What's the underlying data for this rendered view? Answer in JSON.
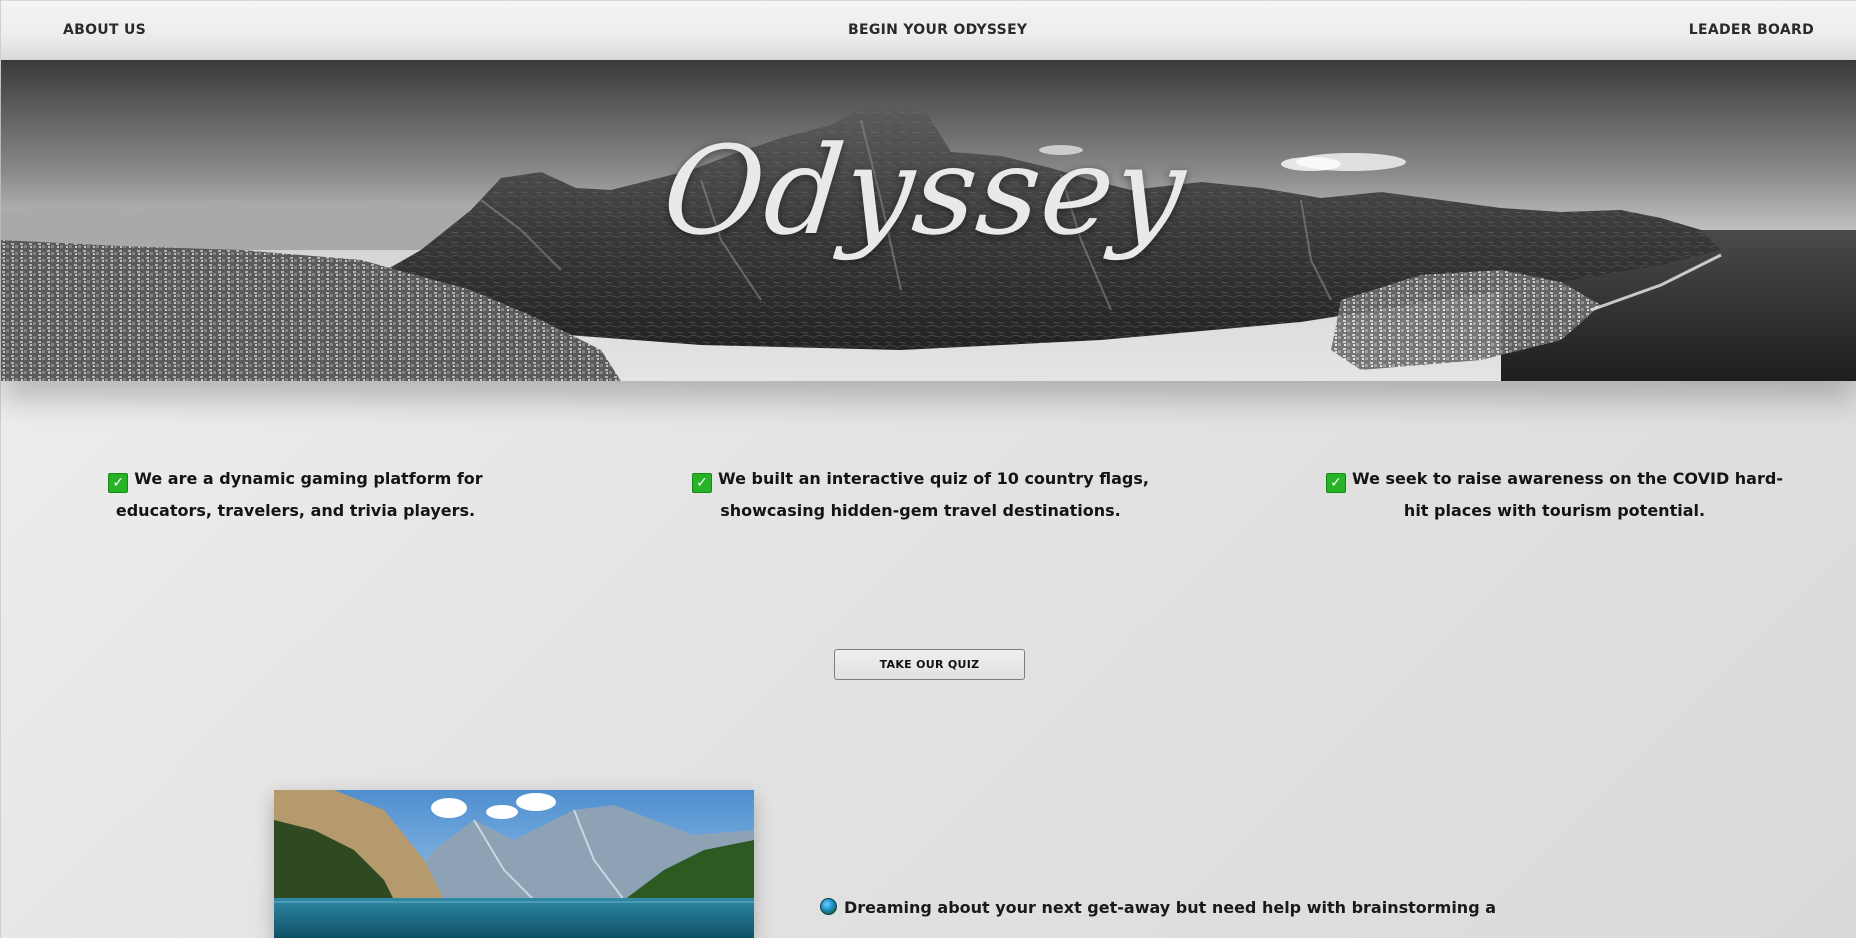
{
  "nav": {
    "about": "ABOUT US",
    "begin": "BEGIN YOUR ODYSSEY",
    "leader": "LEADER BOARD"
  },
  "hero": {
    "title": "Odyssey"
  },
  "features": [
    {
      "icon": "check-box-icon",
      "text": "We are a dynamic gaming platform for educators, travelers, and trivia players."
    },
    {
      "icon": "check-box-icon",
      "text": "We built an interactive quiz of 10 country flags, showcasing hidden-gem travel destinations."
    },
    {
      "icon": "check-box-icon",
      "text": "We seek to raise awareness on the COVID hard-hit places with tourism potential."
    }
  ],
  "quiz_button": {
    "label": "TAKE OUR QUIZ"
  },
  "dream": {
    "icon": "globe-icon",
    "text": "Dreaming about your next get-away but need help with brainstorming a"
  },
  "colors": {
    "check_green": "#28b226",
    "page_bg": "#e6e6e6",
    "text": "#141414"
  }
}
